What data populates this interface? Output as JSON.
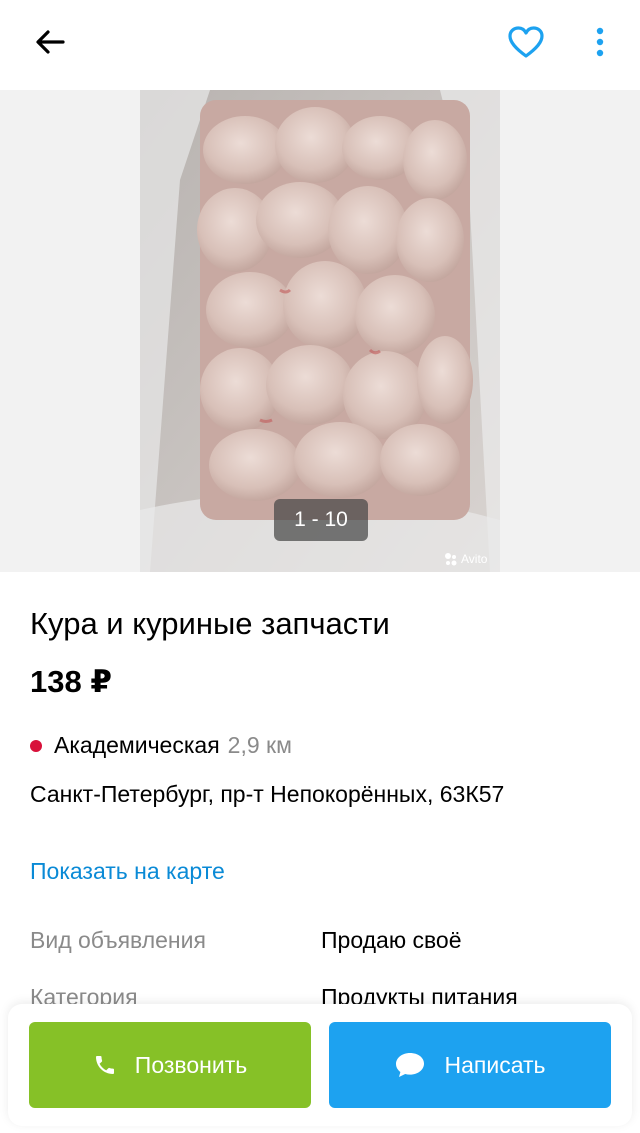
{
  "colors": {
    "accent": "#1da2f0",
    "call_button": "#86c127",
    "link": "#0a8ad6",
    "metro_line": "#d8113a",
    "muted_text": "#8a8a8a"
  },
  "header": {
    "back_icon": "arrow-left-icon",
    "favorite_icon": "heart-outline-icon",
    "more_icon": "more-vertical-icon"
  },
  "gallery": {
    "counter": "1 - 10",
    "watermark": "Avito"
  },
  "listing": {
    "title": "Кура и куриные запчасти",
    "price": "138 ₽"
  },
  "location": {
    "metro": "Академическая",
    "distance": "2,9 км",
    "address": "Санкт-Петербург, пр-т Непокорённых, 63К57",
    "map_link": "Показать на карте"
  },
  "params": [
    {
      "label": "Вид объявления",
      "value": "Продаю своё"
    },
    {
      "label": "Категория",
      "value": "Продукты питания"
    }
  ],
  "actions": {
    "call": "Позвонить",
    "write": "Написать"
  }
}
